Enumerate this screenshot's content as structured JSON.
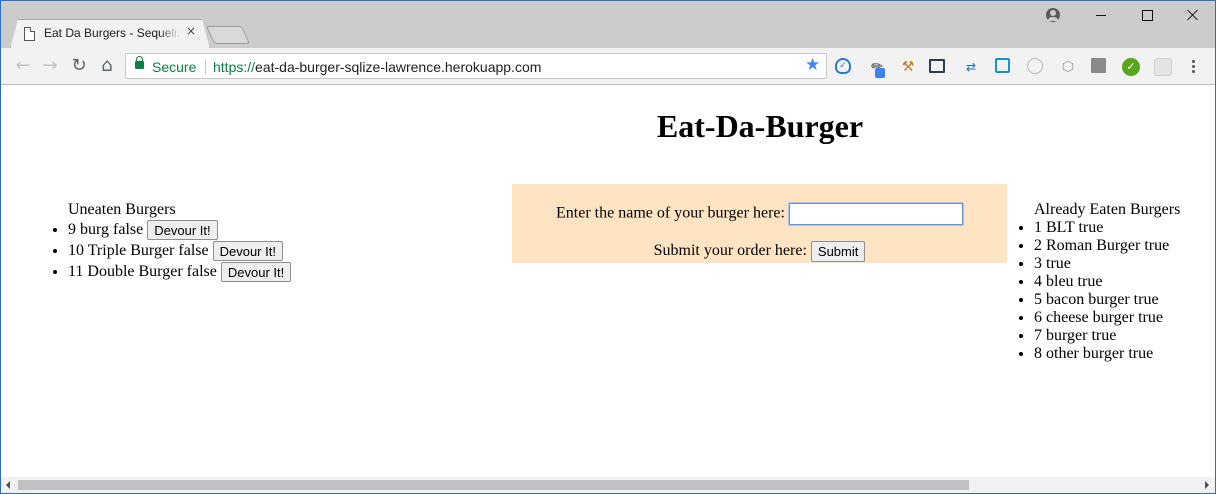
{
  "browser": {
    "tab_title": "Eat Da Burgers - Sequelize",
    "tab_close": "×",
    "secure_label": "Secure",
    "url_scheme": "https://",
    "url_rest": "eat-da-burger-sqlize-lawrence.herokuapp.com",
    "accent_color": "#4285f4",
    "secure_color": "#0b8043"
  },
  "page": {
    "title": "Eat-Da-Burger",
    "uneaten": {
      "heading": "Uneaten Burgers",
      "items": [
        {
          "text": "9 burg false",
          "button": "Devour It!"
        },
        {
          "text": "10 Triple Burger false",
          "button": "Devour It!"
        },
        {
          "text": "11 Double Burger false",
          "button": "Devour It!"
        }
      ]
    },
    "form": {
      "name_label": "Enter the name of your burger here:",
      "name_value": "",
      "submit_label": "Submit your order here:",
      "submit_button": "Submit",
      "panel_color": "#ffe4c4"
    },
    "eaten": {
      "heading": "Already Eaten Burgers",
      "items": [
        "1 BLT true",
        "2 Roman Burger true",
        "3 true",
        "4 bleu true",
        "5 bacon burger true",
        "6 cheese burger true",
        "7 burger true",
        "8 other burger true"
      ]
    }
  }
}
